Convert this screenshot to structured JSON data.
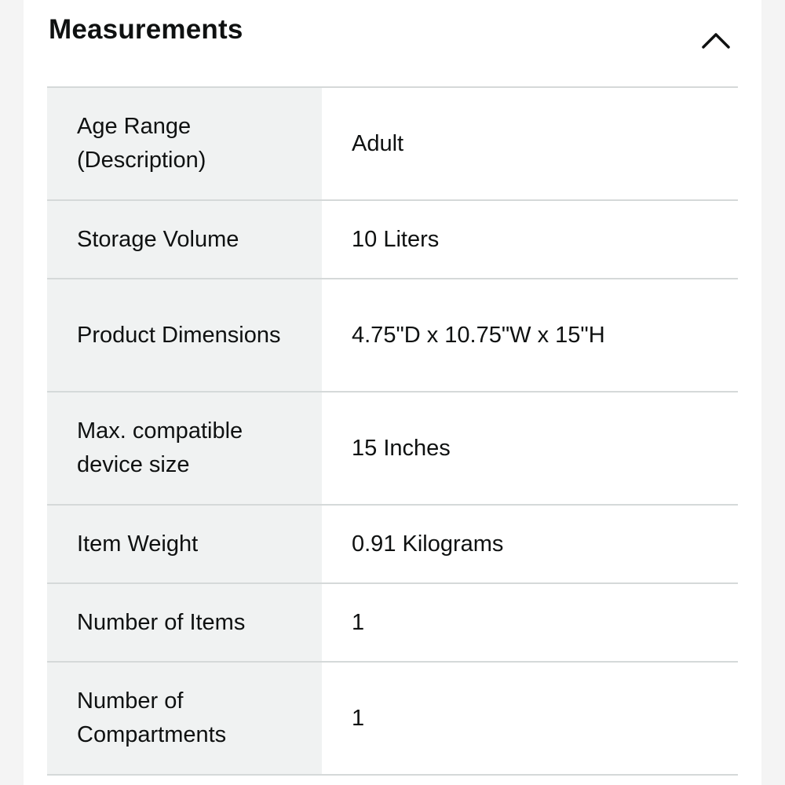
{
  "section": {
    "title": "Measurements",
    "toggle_icon": "chevron-up-icon"
  },
  "rows": [
    {
      "label": "Age Range (Description)",
      "value": "Adult"
    },
    {
      "label": "Storage Volume",
      "value": "10 Liters"
    },
    {
      "label": "Product Dimensions",
      "value": "4.75\"D x 10.75\"W x 15\"H"
    },
    {
      "label": "Max. compatible device size",
      "value": "15 Inches"
    },
    {
      "label": "Item Weight",
      "value": "0.91 Kilograms"
    },
    {
      "label": "Number of Items",
      "value": "1"
    },
    {
      "label": "Number of Compartments",
      "value": "1"
    }
  ],
  "colors": {
    "label_background": "#f0f2f2",
    "divider": "#d5d9d9",
    "text": "#0f1111"
  }
}
